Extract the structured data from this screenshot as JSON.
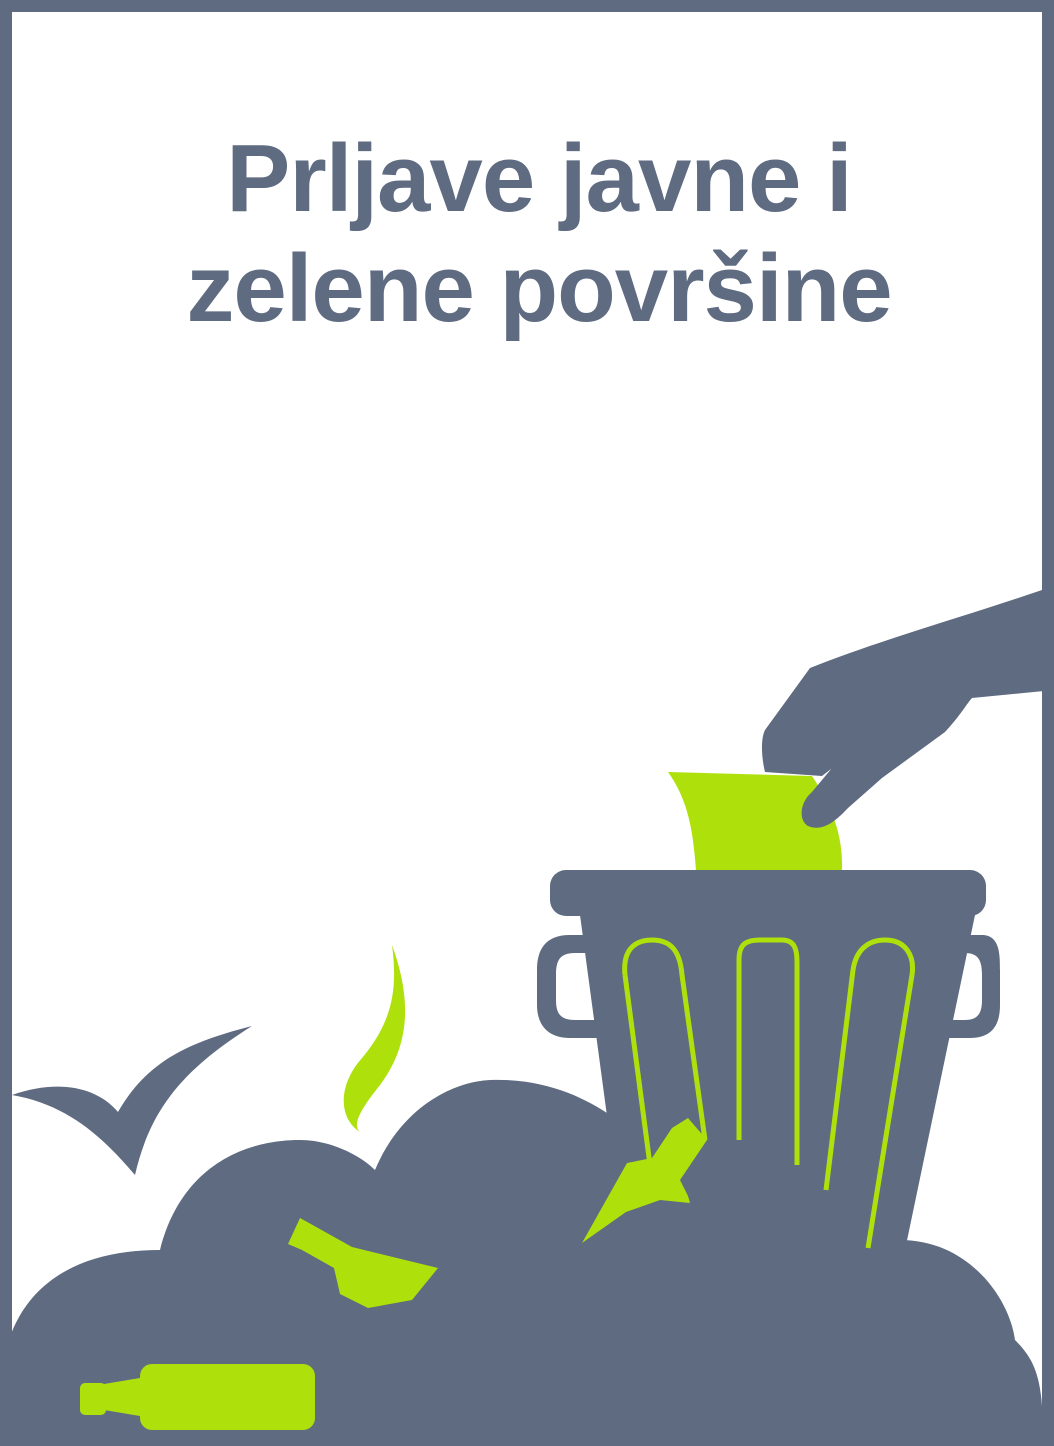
{
  "title": {
    "line1": "Prljave javne i",
    "line2": "zelene površine"
  },
  "colors": {
    "frame": "#5e6b80",
    "slate": "#5e6b80",
    "accent": "#aee10c",
    "background": "#ffffff"
  },
  "icons": [
    "hand-icon",
    "paper-icon",
    "trash-can-icon",
    "garbage-pile-icon",
    "bottle-icon",
    "bird-icon",
    "smell-wisp-icon"
  ]
}
